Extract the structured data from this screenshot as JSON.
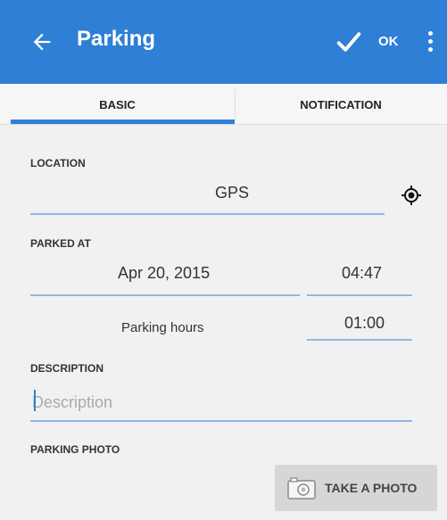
{
  "appbar": {
    "title": "Parking",
    "ok_label": "OK",
    "color": "#2f7fd6",
    "icons": [
      "arrow-back-icon",
      "check-icon",
      "more-vert-icon"
    ]
  },
  "tabs": [
    {
      "label": "BASIC",
      "selected": true
    },
    {
      "label": "NOTIFICATION",
      "selected": false
    }
  ],
  "location": {
    "label": "LOCATION",
    "value": "GPS",
    "icon": "crosshair-icon"
  },
  "parked_at": {
    "label": "PARKED AT",
    "date": "Apr 20, 2015",
    "time": "04:47"
  },
  "parking_hours": {
    "label": "Parking hours",
    "value": "01:00"
  },
  "description": {
    "label": "DESCRIPTION",
    "placeholder": "Description",
    "value": ""
  },
  "photo": {
    "label": "PARKING PHOTO",
    "button_label": "TAKE A PHOTO",
    "icon": "camera-icon"
  }
}
